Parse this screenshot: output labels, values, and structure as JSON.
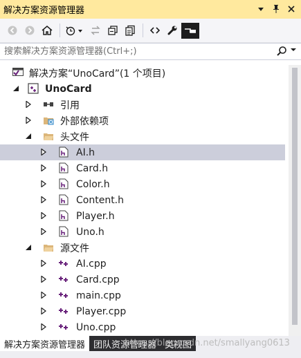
{
  "window": {
    "title": "解决方案资源管理器"
  },
  "search": {
    "placeholder": "搜索解决方案资源管理器(Ctrl+;)"
  },
  "tree": {
    "solution_label": "解决方案“UnoCard”(1 个项目)",
    "project_label": "UnoCard",
    "references_label": "引用",
    "external_deps_label": "外部依赖项",
    "header_folder_label": "头文件",
    "header_files": [
      "AI.h",
      "Card.h",
      "Color.h",
      "Content.h",
      "Player.h",
      "Uno.h"
    ],
    "source_folder_label": "源文件",
    "source_files": [
      "AI.cpp",
      "Card.cpp",
      "main.cpp",
      "Player.cpp",
      "Uno.cpp"
    ],
    "selected_file": "AI.h"
  },
  "tabs": {
    "items": [
      "解决方案资源管理器",
      "团队资源管理器",
      "类视图"
    ]
  },
  "watermark": "https://blog.csdn.net/smallyang0613",
  "colors": {
    "title_bg": "#ffe99e",
    "selected_row": "#cccedb",
    "header_icon": "#68217a",
    "folder": "#dcb67a"
  }
}
